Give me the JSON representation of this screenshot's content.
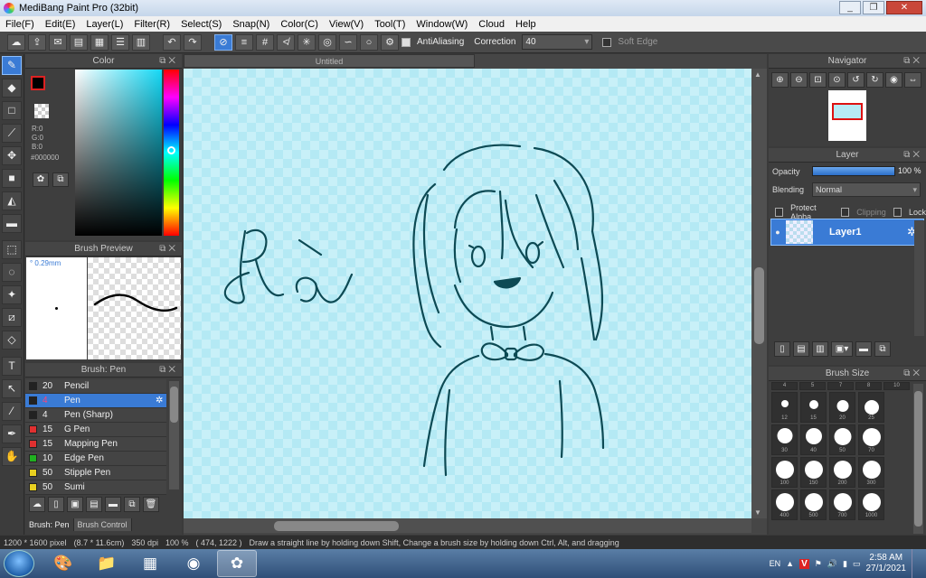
{
  "window": {
    "title": "MediBang Paint Pro (32bit)",
    "controls": [
      "_",
      "❐",
      "✕"
    ]
  },
  "menu": [
    "File(F)",
    "Edit(E)",
    "Layer(L)",
    "Filter(R)",
    "Select(S)",
    "Snap(N)",
    "Color(C)",
    "View(V)",
    "Tool(T)",
    "Window(W)",
    "Cloud",
    "Help"
  ],
  "toolbar": {
    "antialiasing_label": "AntiAliasing",
    "correction_label": "Correction",
    "correction_value": "40",
    "soft_edge_label": "Soft Edge"
  },
  "color_panel": {
    "title": "Color",
    "r": "R:0",
    "g": "G:0",
    "b": "B:0",
    "hex": "#000000"
  },
  "brush_preview": {
    "title": "Brush Preview",
    "size": "° 0.29mm"
  },
  "brush_panel": {
    "title": "Brush: Pen",
    "items": [
      {
        "size": "20",
        "name": "Pencil",
        "color": "#222222"
      },
      {
        "size": "4",
        "name": "Pen",
        "color": "#222222"
      },
      {
        "size": "4",
        "name": "Pen (Sharp)",
        "color": "#222222"
      },
      {
        "size": "15",
        "name": "G Pen",
        "color": "#e03030"
      },
      {
        "size": "15",
        "name": "Mapping Pen",
        "color": "#e03030"
      },
      {
        "size": "10",
        "name": "Edge Pen",
        "color": "#20b020"
      },
      {
        "size": "50",
        "name": "Stipple Pen",
        "color": "#e8d020"
      },
      {
        "size": "50",
        "name": "Sumi",
        "color": "#e8d020"
      }
    ],
    "tabs": [
      "Brush: Pen",
      "Brush Control"
    ]
  },
  "canvas": {
    "tab_title": "Untitled",
    "handwriting": "Rà"
  },
  "navigator": {
    "title": "Navigator"
  },
  "layer_panel": {
    "title": "Layer",
    "opacity_label": "Opacity",
    "opacity_value": "100 %",
    "opacity_fraction": 1.0,
    "blending_label": "Blending",
    "blending_value": "Normal",
    "protect_alpha": "Protect Alpha",
    "clipping": "Clipping",
    "lock": "Lock",
    "layer_name": "Layer1"
  },
  "brush_size": {
    "title": "Brush Size",
    "top_row": [
      "4",
      "5",
      "7",
      "8",
      "10"
    ],
    "sizes": [
      "12",
      "15",
      "20",
      "25",
      "30",
      "40",
      "50",
      "70",
      "100",
      "150",
      "200",
      "300",
      "400",
      "500",
      "700",
      "1000"
    ]
  },
  "status": {
    "dimensions": "1200 * 1600 pixel",
    "physical": "(8.7 * 11.6cm)",
    "dpi": "350 dpi",
    "zoom": "100 %",
    "coords": "( 474, 1222 )",
    "hint": "Draw a straight line by holding down Shift, Change a brush size by holding down Ctrl, Alt, and dragging"
  },
  "taskbar": {
    "lang": "EN",
    "time": "2:58 AM",
    "date": "27/1/2021"
  },
  "colors": {
    "accent": "#3a7bd5",
    "canvas_fill": "#b7eaf5",
    "ink": "#0d4a54"
  }
}
